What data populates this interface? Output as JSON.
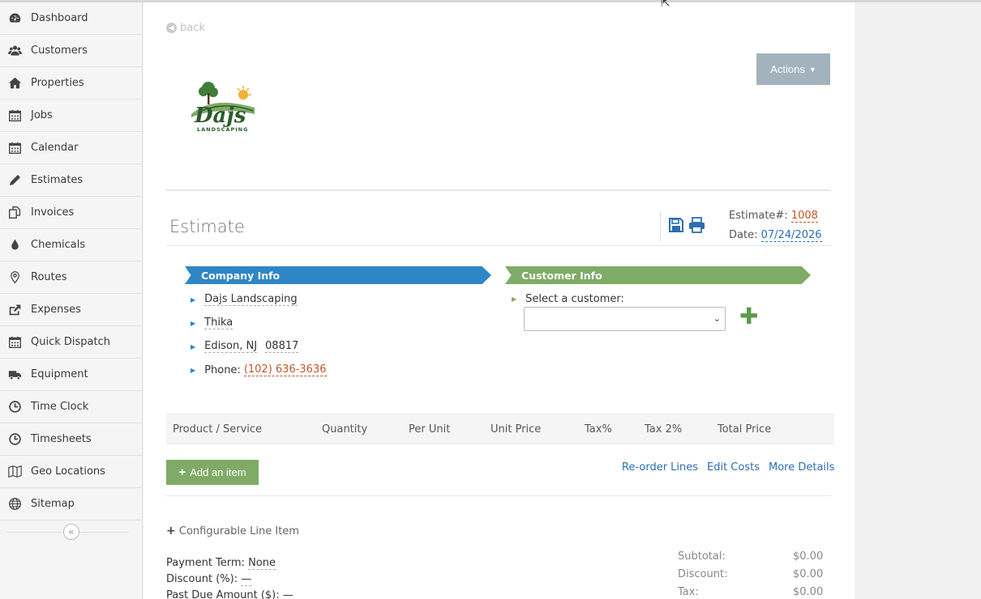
{
  "sidebar": {
    "items": [
      {
        "label": "Dashboard",
        "icon": "dashboard-icon"
      },
      {
        "label": "Customers",
        "icon": "users-icon"
      },
      {
        "label": "Properties",
        "icon": "home-icon"
      },
      {
        "label": "Jobs",
        "icon": "calendar-icon"
      },
      {
        "label": "Calendar",
        "icon": "calendar-icon"
      },
      {
        "label": "Estimates",
        "icon": "pencil-icon"
      },
      {
        "label": "Invoices",
        "icon": "copy-icon"
      },
      {
        "label": "Chemicals",
        "icon": "drop-icon"
      },
      {
        "label": "Routes",
        "icon": "map-marker-icon"
      },
      {
        "label": "Expenses",
        "icon": "share-icon"
      },
      {
        "label": "Quick Dispatch",
        "icon": "calendar-icon"
      },
      {
        "label": "Equipment",
        "icon": "truck-icon"
      },
      {
        "label": "Time Clock",
        "icon": "clock-icon"
      },
      {
        "label": "Timesheets",
        "icon": "clock-icon"
      },
      {
        "label": "Geo Locations",
        "icon": "map-icon"
      },
      {
        "label": "Sitemap",
        "icon": "globe-icon"
      }
    ],
    "collapse_glyph": "«"
  },
  "header": {
    "back_label": "back",
    "actions_label": "Actions"
  },
  "logo": {
    "word": "Dajs",
    "sub": "LANDSCAPING"
  },
  "estimate": {
    "title": "Estimate",
    "number_label": "Estimate#:",
    "number": "1008",
    "date_label": "Date:",
    "date": "07/24/2026"
  },
  "company": {
    "ribbon": "Company Info",
    "name": "Dajs Landscaping",
    "address1": "Thika",
    "city_state": "Edison, NJ",
    "zip": "08817",
    "phone_label": "Phone:",
    "phone": "(102) 636-3636"
  },
  "customer": {
    "ribbon": "Customer Info",
    "select_label": "Select a customer:",
    "selected": ""
  },
  "table": {
    "columns": [
      "Product / Service",
      "Quantity",
      "Per Unit",
      "Unit Price",
      "Tax%",
      "Tax 2%",
      "Total Price"
    ]
  },
  "line_actions": {
    "add_item": "Add an item",
    "reorder": "Re-order Lines",
    "edit_costs": "Edit Costs",
    "more_details": "More Details",
    "configurable": "Configurable Line Item"
  },
  "terms": {
    "payment_term_label": "Payment Term:",
    "payment_term": "None",
    "discount_label": "Discount (%):",
    "discount": "—",
    "past_due_label": "Past Due Amount ($):",
    "past_due": "—"
  },
  "totals": [
    {
      "label": "Subtotal:",
      "value": "$0.00"
    },
    {
      "label": "Discount:",
      "value": "$0.00"
    },
    {
      "label": "Tax:",
      "value": "$0.00"
    }
  ],
  "colors": {
    "blue": "#2f86c6",
    "green": "#7fab67",
    "accent_orange": "#c0552a",
    "actions_gray": "#a3b3bd"
  }
}
